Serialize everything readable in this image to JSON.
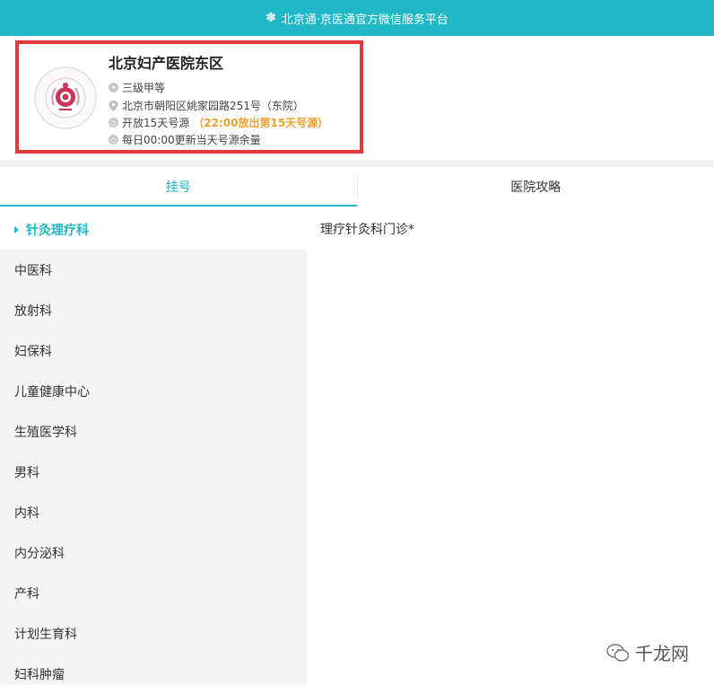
{
  "topbar": {
    "icon": "snowflake-icon",
    "title": "北京通·京医通官方微信服务平台"
  },
  "hospital": {
    "name": "北京妇产医院东区",
    "level": "三级甲等",
    "address": "北京市朝阳区姚家园路251号（东院）",
    "open_days": "开放15天号源",
    "release_note": "（22:00放出第15天号源）",
    "update_note": "每日00:00更新当天号源余量"
  },
  "tabs": [
    {
      "label": "挂号",
      "active": true
    },
    {
      "label": "医院攻略",
      "active": false
    }
  ],
  "departments": [
    {
      "label": "针灸理疗科",
      "active": true
    },
    {
      "label": "中医科"
    },
    {
      "label": "放射科"
    },
    {
      "label": "妇保科"
    },
    {
      "label": "儿童健康中心"
    },
    {
      "label": "生殖医学科"
    },
    {
      "label": "男科"
    },
    {
      "label": "内科"
    },
    {
      "label": "内分泌科"
    },
    {
      "label": "产科"
    },
    {
      "label": "计划生育科"
    },
    {
      "label": "妇科肿瘤"
    }
  ],
  "content": {
    "clinic": "理疗针灸科门诊*"
  },
  "watermark": {
    "text": "千龙网",
    "icon": "wechat-icon"
  },
  "colors": {
    "accent": "#20b7c7",
    "highlight": "#e23a3a",
    "orange": "#f0a030"
  }
}
